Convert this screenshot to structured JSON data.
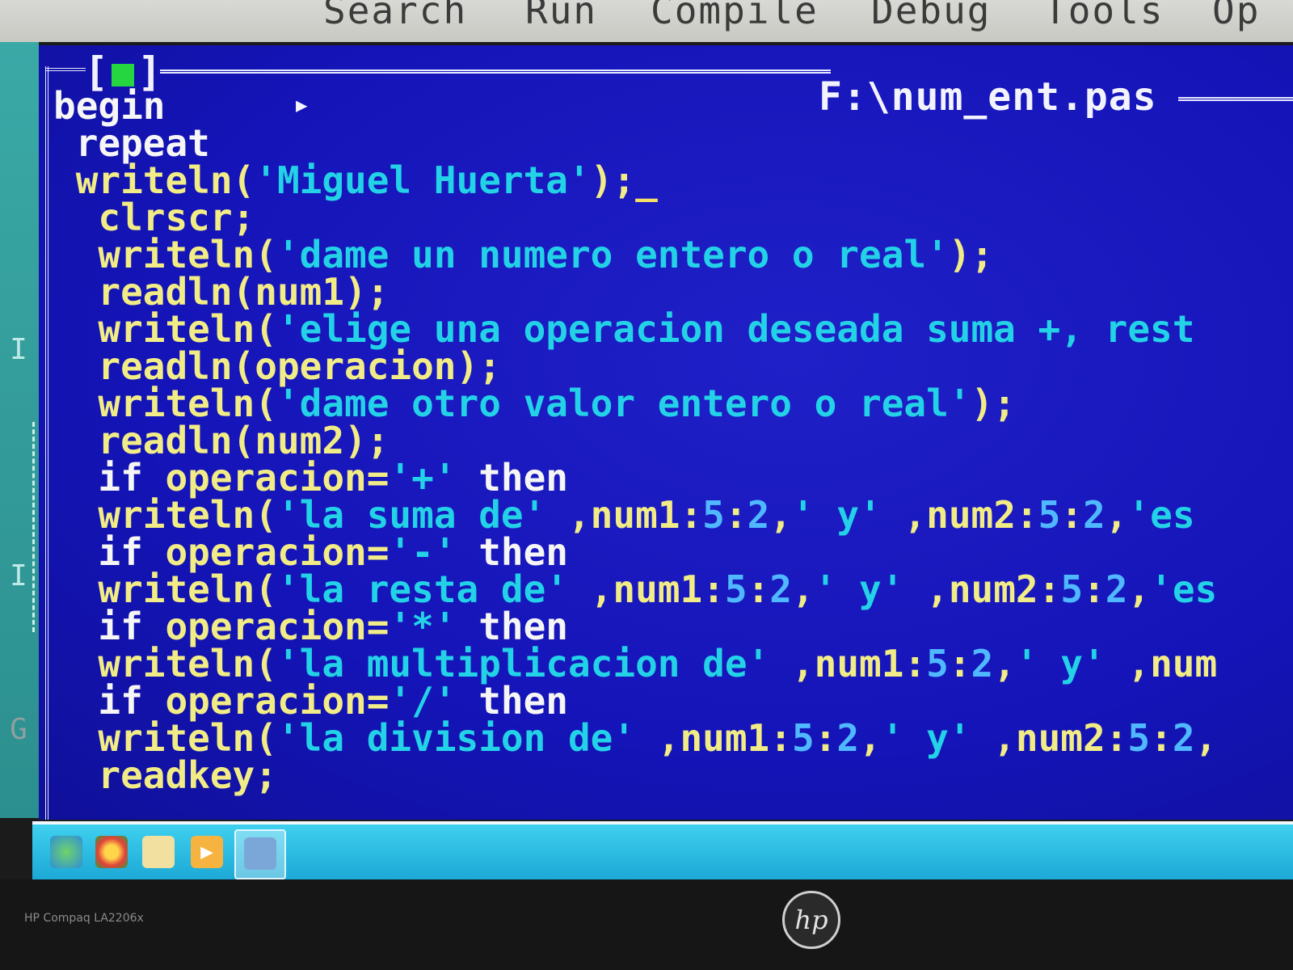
{
  "menu": {
    "items": [
      "Search",
      "Run",
      "Compile",
      "Debug",
      "Tools",
      "Op"
    ]
  },
  "window": {
    "close_box": "[■]",
    "filename": "F:\\num_ent.pas"
  },
  "left_strip": {
    "marks": [
      "I",
      "I",
      "G"
    ]
  },
  "code": {
    "lines": [
      [
        {
          "t": "begin",
          "c": "kw"
        }
      ],
      [
        {
          "t": " repeat",
          "c": "kw"
        }
      ],
      [
        {
          "t": " writeln(",
          "c": "pr"
        },
        {
          "t": "'Miguel Huerta'",
          "c": "st"
        },
        {
          "t": ");",
          "c": "pr"
        },
        {
          "t": "_",
          "c": "cursor"
        }
      ],
      [
        {
          "t": "  clrscr;",
          "c": "pr"
        }
      ],
      [
        {
          "t": "  writeln(",
          "c": "pr"
        },
        {
          "t": "'dame un numero entero o real'",
          "c": "st"
        },
        {
          "t": ");",
          "c": "pr"
        }
      ],
      [
        {
          "t": "  readln(num1);",
          "c": "pr"
        }
      ],
      [
        {
          "t": "  writeln(",
          "c": "pr"
        },
        {
          "t": "'elige una operacion deseada suma +, rest",
          "c": "st"
        }
      ],
      [
        {
          "t": "  readln(operacion);",
          "c": "pr"
        }
      ],
      [
        {
          "t": "  writeln(",
          "c": "pr"
        },
        {
          "t": "'dame otro valor entero o real'",
          "c": "st"
        },
        {
          "t": ");",
          "c": "pr"
        }
      ],
      [
        {
          "t": "  readln(num2);",
          "c": "pr"
        }
      ],
      [
        {
          "t": "  if ",
          "c": "kw"
        },
        {
          "t": "operacion=",
          "c": "pr"
        },
        {
          "t": "'+'",
          "c": "st"
        },
        {
          "t": " then",
          "c": "kw"
        }
      ],
      [
        {
          "t": "  writeln(",
          "c": "pr"
        },
        {
          "t": "'la suma de'",
          "c": "st"
        },
        {
          "t": " ,num1:",
          "c": "pr"
        },
        {
          "t": "5",
          "c": "nm"
        },
        {
          "t": ":",
          "c": "pr"
        },
        {
          "t": "2",
          "c": "nm"
        },
        {
          "t": ",",
          "c": "pr"
        },
        {
          "t": "' y'",
          "c": "st"
        },
        {
          "t": " ,num2:",
          "c": "pr"
        },
        {
          "t": "5",
          "c": "nm"
        },
        {
          "t": ":",
          "c": "pr"
        },
        {
          "t": "2",
          "c": "nm"
        },
        {
          "t": ",",
          "c": "pr"
        },
        {
          "t": "'es",
          "c": "st"
        }
      ],
      [
        {
          "t": "  if ",
          "c": "kw"
        },
        {
          "t": "operacion=",
          "c": "pr"
        },
        {
          "t": "'-'",
          "c": "st"
        },
        {
          "t": " then",
          "c": "kw"
        }
      ],
      [
        {
          "t": "  writeln(",
          "c": "pr"
        },
        {
          "t": "'la resta de'",
          "c": "st"
        },
        {
          "t": " ,num1:",
          "c": "pr"
        },
        {
          "t": "5",
          "c": "nm"
        },
        {
          "t": ":",
          "c": "pr"
        },
        {
          "t": "2",
          "c": "nm"
        },
        {
          "t": ",",
          "c": "pr"
        },
        {
          "t": "' y'",
          "c": "st"
        },
        {
          "t": " ,num2:",
          "c": "pr"
        },
        {
          "t": "5",
          "c": "nm"
        },
        {
          "t": ":",
          "c": "pr"
        },
        {
          "t": "2",
          "c": "nm"
        },
        {
          "t": ",",
          "c": "pr"
        },
        {
          "t": "'es",
          "c": "st"
        }
      ],
      [
        {
          "t": "  if ",
          "c": "kw"
        },
        {
          "t": "operacion=",
          "c": "pr"
        },
        {
          "t": "'*'",
          "c": "st"
        },
        {
          "t": " then",
          "c": "kw"
        }
      ],
      [
        {
          "t": "  writeln(",
          "c": "pr"
        },
        {
          "t": "'la multiplicacion de'",
          "c": "st"
        },
        {
          "t": " ,num1:",
          "c": "pr"
        },
        {
          "t": "5",
          "c": "nm"
        },
        {
          "t": ":",
          "c": "pr"
        },
        {
          "t": "2",
          "c": "nm"
        },
        {
          "t": ",",
          "c": "pr"
        },
        {
          "t": "' y'",
          "c": "st"
        },
        {
          "t": " ,num",
          "c": "pr"
        }
      ],
      [
        {
          "t": "  if ",
          "c": "kw"
        },
        {
          "t": "operacion=",
          "c": "pr"
        },
        {
          "t": "'/'",
          "c": "st"
        },
        {
          "t": " then",
          "c": "kw"
        }
      ],
      [
        {
          "t": "  writeln(",
          "c": "pr"
        },
        {
          "t": "'la division de'",
          "c": "st"
        },
        {
          "t": " ,num1:",
          "c": "pr"
        },
        {
          "t": "5",
          "c": "nm"
        },
        {
          "t": ":",
          "c": "pr"
        },
        {
          "t": "2",
          "c": "nm"
        },
        {
          "t": ",",
          "c": "pr"
        },
        {
          "t": "' y'",
          "c": "st"
        },
        {
          "t": " ,num2:",
          "c": "pr"
        },
        {
          "t": "5",
          "c": "nm"
        },
        {
          "t": ":",
          "c": "pr"
        },
        {
          "t": "2",
          "c": "nm"
        },
        {
          "t": ",",
          "c": "pr"
        }
      ],
      [
        {
          "t": "  readkey;",
          "c": "pr"
        }
      ]
    ]
  },
  "taskbar": {
    "icons": [
      "start-orb-icon",
      "chrome-icon",
      "folder-icon",
      "media-player-icon",
      "turbo-pascal-icon"
    ]
  },
  "monitor": {
    "model": "HP Compaq LA2206x",
    "logo": "hp"
  },
  "colors": {
    "editor_bg": "#1414b8",
    "keyword": "#f6f6f6",
    "procedure": "#f2ec86",
    "string": "#23d2e6",
    "number": "#4fb8ff",
    "taskbar": "#1aa6d4"
  }
}
